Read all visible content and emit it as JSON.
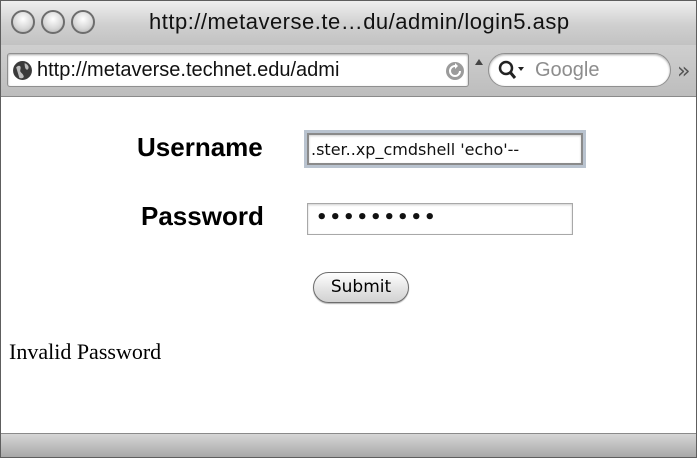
{
  "window": {
    "title": "http://metaverse.te…du/admin/login5.asp"
  },
  "toolbar": {
    "address_url": "http://metaverse.technet.edu/admi",
    "search_placeholder": "Google",
    "overflow_symbol": "»"
  },
  "form": {
    "username_label": "Username",
    "username_value": ".ster..xp_cmdshell 'echo'--",
    "password_label": "Password",
    "password_value": "•••••••••",
    "submit_label": "Submit"
  },
  "status_message": "Invalid Password",
  "icons": {
    "close": "close-icon",
    "minimize": "minimize-icon",
    "zoom": "zoom-icon",
    "site": "globe-icon",
    "reload": "reload-icon",
    "snapback": "snapback-icon",
    "search": "search-icon"
  }
}
